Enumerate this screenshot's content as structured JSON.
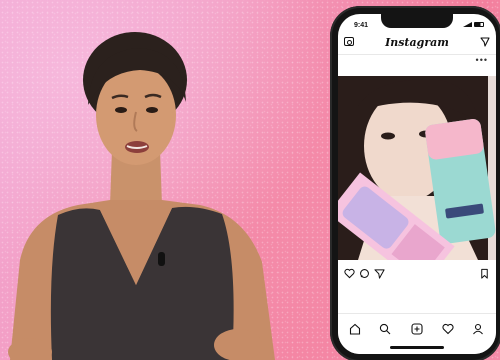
{
  "phone": {
    "time": "9:41",
    "app_title": "Instagram",
    "more_label": "•••"
  },
  "icons": {
    "camera": "camera-icon",
    "direct": "direct-message-icon",
    "like": "heart-icon",
    "comment": "comment-icon",
    "share": "share-icon",
    "save": "bookmark-icon",
    "home": "home-icon",
    "search": "search-icon",
    "add": "add-post-icon",
    "activity": "heart-icon",
    "profile": "profile-icon"
  },
  "colors": {
    "background_pink": "#f39cc0",
    "background_coral": "#f37f9d",
    "dress": "#3a3436"
  }
}
